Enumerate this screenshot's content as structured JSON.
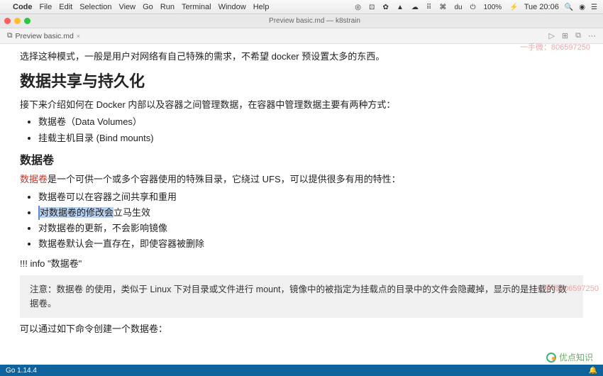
{
  "menubar": {
    "apple": "",
    "appname": "Code",
    "items": [
      "File",
      "Edit",
      "Selection",
      "View",
      "Go",
      "Run",
      "Terminal",
      "Window",
      "Help"
    ],
    "right_icons": [
      "◎",
      "⊡",
      "✿",
      "▲",
      "☁",
      "⠿",
      "⌘",
      "du",
      "⏻",
      "100%",
      "⚡"
    ],
    "clock": "Tue 20:06",
    "search": "🔍",
    "siri": "◉",
    "cc": "☰"
  },
  "window": {
    "title": "Preview basic.md — k8strain"
  },
  "tab": {
    "icon": "⧉",
    "label": "Preview basic.md",
    "close": "×"
  },
  "tabright": [
    "▷",
    "⊞",
    "⧉",
    "⋯"
  ],
  "doc": {
    "p0": "选择这种模式，一般是用户对网络有自己特殊的需求，不希望 docker 预设置太多的东西。",
    "h2": "数据共享与持久化",
    "p1": "接下来介绍如何在 Docker 内部以及容器之间管理数据，在容器中管理数据主要有两种方式：",
    "l1a": "数据卷（Data Volumes）",
    "l1b": "挂载主机目录 (Bind mounts)",
    "h3": "数据卷",
    "p2a": "数据卷",
    "p2b": "是一个可供一个或多个容器使用的特殊目录，它绕过 UFS，可以提供很多有用的特性：",
    "l2a": "数据卷可以在容器之间共享和重用",
    "l2b_hl": "对数据卷的修改会",
    "l2b_tail": "立马生效",
    "l2c": "对数据卷的更新，不会影响镜像",
    "l2d": "数据卷默认会一直存在，即使容器被删除",
    "info_head": "!!! info \"数据卷\"",
    "infobox": "注意：数据卷 的使用，类似于 Linux 下对目录或文件进行 mount，镜像中的被指定为挂载点的目录中的文件会隐藏掉，显示的是挂载的 数据卷。",
    "p3": "可以通过如下命令创建一个数据卷："
  },
  "watermark1": "一手微：806597250",
  "watermark2": "一手微806597250",
  "brand": "优点知识",
  "status": {
    "left": "Go 1.14.4",
    "bell": "🔔"
  }
}
